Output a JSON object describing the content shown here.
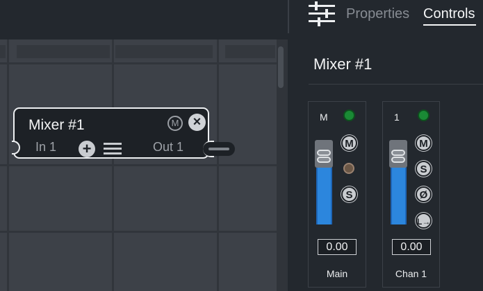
{
  "tabs": {
    "properties": "Properties",
    "controls": "Controls",
    "active": "controls"
  },
  "panel": {
    "title": "Mixer #1"
  },
  "node": {
    "title": "Mixer #1",
    "mute_label": "M",
    "input_label": "In 1",
    "output_label": "Out 1",
    "icons": [
      "mute-icon",
      "close-icon",
      "add-icon",
      "menu-icon"
    ]
  },
  "strips": [
    {
      "header": "M",
      "buttons": [
        "M",
        "S"
      ],
      "value": "0.00",
      "name": "Main"
    },
    {
      "header": "1",
      "buttons": [
        "M",
        "S",
        "Ø",
        "L→"
      ],
      "value": "0.00",
      "name": "Chan 1"
    }
  ],
  "colors": {
    "background": "#23282e",
    "canvas": "#3d4148",
    "fader_blue": "#2c86dd",
    "led_green": "#1a8a35"
  }
}
